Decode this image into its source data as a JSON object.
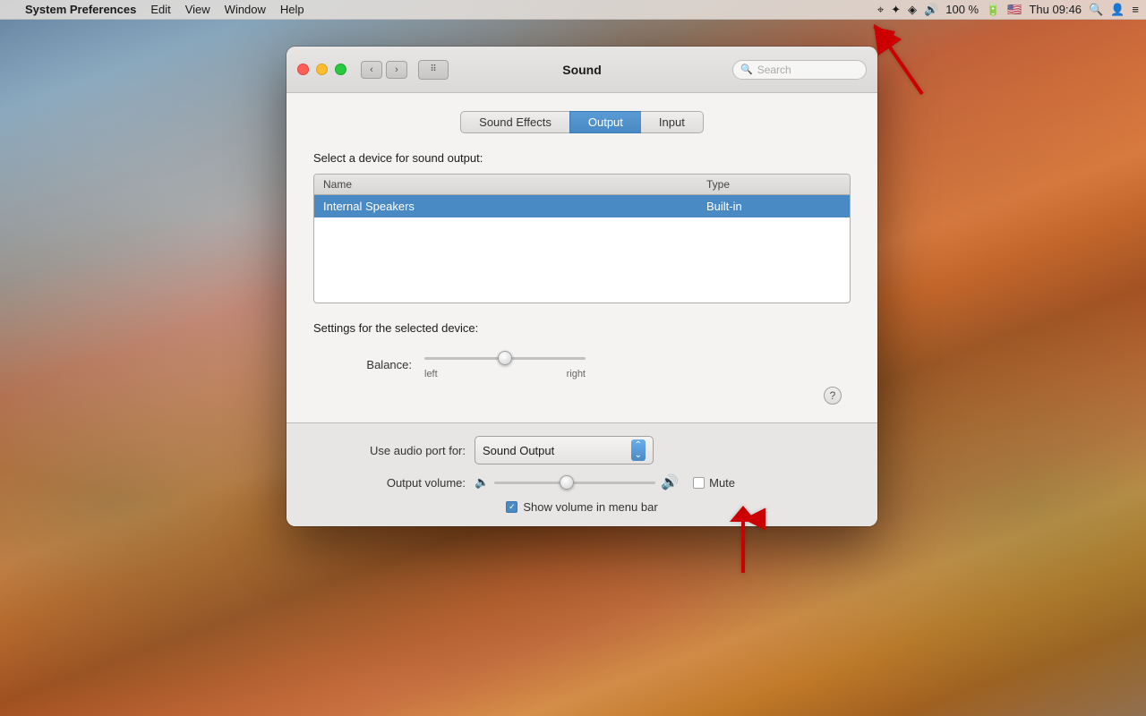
{
  "desktop": {
    "bg_description": "macOS High Sierra mountain lake wallpaper"
  },
  "menubar": {
    "apple_symbol": "",
    "app_name": "System Preferences",
    "menu_items": [
      "Edit",
      "View",
      "Window",
      "Help"
    ],
    "time": "Thu 09:46",
    "battery_pct": "100 %",
    "icons": {
      "target": "⌖",
      "bluetooth": "✦",
      "wifi": "◦",
      "volume": "◉",
      "battery_icon": "▮▮▮▮",
      "flag": "🇺🇸",
      "search": "⌕",
      "avatar": "●",
      "list": "≡"
    }
  },
  "window": {
    "title": "Sound",
    "search_placeholder": "Search",
    "tabs": [
      {
        "label": "Sound Effects",
        "active": false
      },
      {
        "label": "Output",
        "active": true
      },
      {
        "label": "Input",
        "active": false
      }
    ],
    "device_section": {
      "heading": "Select a device for sound output:",
      "columns": [
        {
          "label": "Name",
          "key": "name"
        },
        {
          "label": "Type",
          "key": "type"
        }
      ],
      "devices": [
        {
          "name": "Internal Speakers",
          "type": "Built-in",
          "selected": true
        }
      ]
    },
    "settings_section": {
      "heading": "Settings for the selected device:",
      "balance": {
        "label": "Balance:",
        "left_label": "left",
        "right_label": "right",
        "value": 50
      }
    },
    "bottom": {
      "audio_port_label": "Use audio port for:",
      "audio_port_value": "Sound Output",
      "output_volume_label": "Output volume:",
      "volume_value": 45,
      "mute_label": "Mute",
      "mute_checked": false,
      "show_volume_label": "Show volume in menu bar",
      "show_volume_checked": true
    }
  }
}
